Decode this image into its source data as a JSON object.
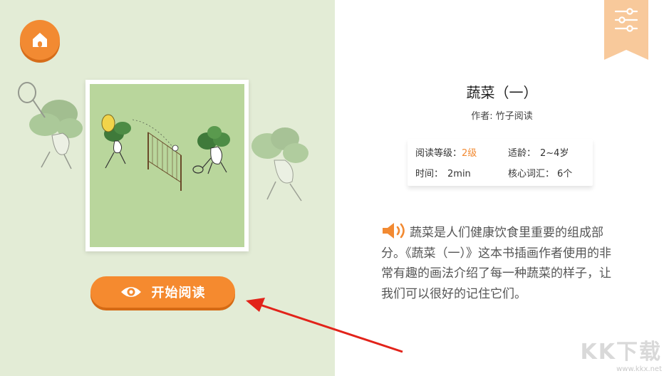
{
  "book": {
    "title": "蔬菜（一）",
    "author": "作者: 竹子阅读"
  },
  "info": {
    "level_label": "阅读等级：",
    "level_value": "2级",
    "age_label": "适龄：",
    "age_value": "2~4岁",
    "time_label": "时间：",
    "time_value": "2min",
    "vocab_label": "核心词汇：",
    "vocab_value": "6个"
  },
  "description": "蔬菜是人们健康饮食里重要的组成部分。《蔬菜（一）》这本书插画作者使用的非常有趣的画法介绍了每一种蔬菜的样子，让我们可以很好的记住它们。",
  "actions": {
    "start_reading": "开始阅读"
  },
  "watermark": {
    "brand": "KK下载",
    "url": "www.kkx.net"
  },
  "colors": {
    "accent": "#f28a32",
    "left_background": "#e3ecd6",
    "cover_background": "#b9d69c"
  },
  "icons": {
    "home": "home-icon",
    "settings": "settings-sliders-icon",
    "eye": "eye-icon",
    "speaker": "speaker-icon"
  }
}
